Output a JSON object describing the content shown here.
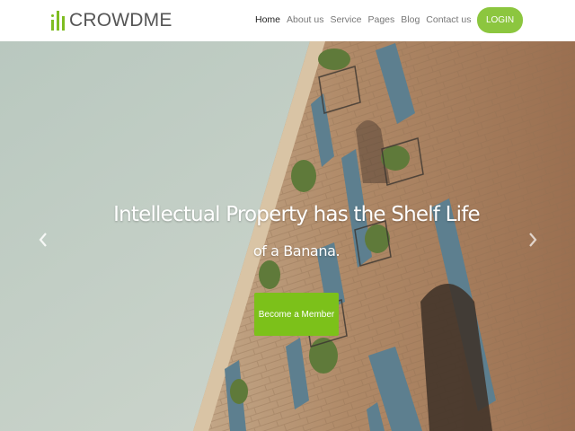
{
  "brand": {
    "name": "CROWDME",
    "accent": "#8cc63f"
  },
  "nav": {
    "items": [
      {
        "label": "Home",
        "active": true
      },
      {
        "label": "About us",
        "active": false
      },
      {
        "label": "Service",
        "active": false
      },
      {
        "label": "Pages",
        "active": false
      },
      {
        "label": "Blog",
        "active": false
      },
      {
        "label": "Contact us",
        "active": false
      }
    ]
  },
  "header": {
    "login_label": "LOGIN"
  },
  "hero": {
    "title": "Intellectual Property has the Shelf Life",
    "subtitle": "of a Banana.",
    "cta_label": "Become a Member",
    "prev_icon": "chevron-left-icon",
    "next_icon": "chevron-right-icon"
  }
}
